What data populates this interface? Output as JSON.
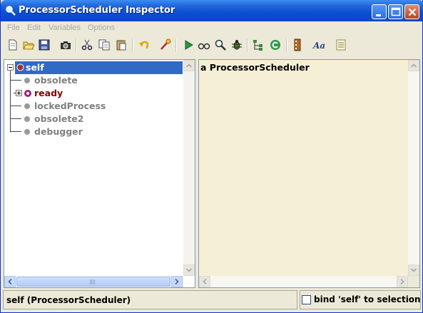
{
  "window": {
    "title": "ProcessorScheduler Inspector"
  },
  "menu": [
    "File",
    "Edit",
    "Variables",
    "Options"
  ],
  "toolbar_icons": [
    "new-icon",
    "open-icon",
    "save-icon",
    "camera-icon",
    "cut-icon",
    "copy-icon",
    "paste-icon",
    "undo-icon",
    "inspect-icon",
    "run-icon",
    "glasses-icon",
    "magnify-icon",
    "debug-bug-icon",
    "hierarchy-icon",
    "refresh-icon",
    "film-icon",
    "font-icon",
    "notes-icon"
  ],
  "tree": {
    "root": "self",
    "items": [
      {
        "label": "obsolete",
        "expandable": false,
        "color": "#808080"
      },
      {
        "label": "ready",
        "expandable": true,
        "color": "#800000"
      },
      {
        "label": "lockedProcess",
        "expandable": false,
        "color": "#808080"
      },
      {
        "label": "obsolete2",
        "expandable": false,
        "color": "#808080"
      },
      {
        "label": "debugger",
        "expandable": false,
        "color": "#808080"
      }
    ]
  },
  "value_pane": {
    "text": "a ProcessorScheduler"
  },
  "status": {
    "text": "self (ProcessorScheduler)",
    "bind_label": "bind 'self' to selection",
    "bind_checked": false
  },
  "colors": {
    "selection": "#316ac5",
    "value_bg": "#f5efd6",
    "title_bar": "#0b4fd2"
  }
}
